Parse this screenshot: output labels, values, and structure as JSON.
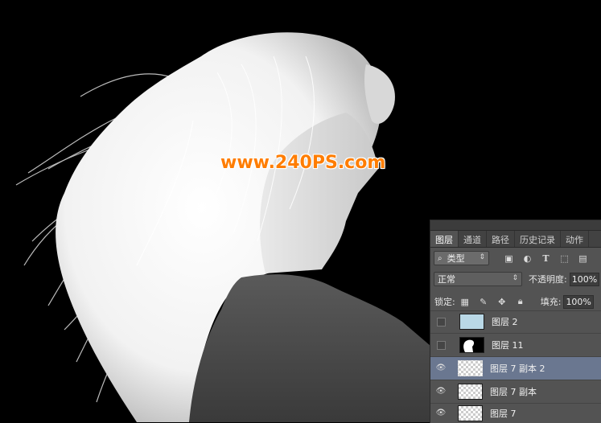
{
  "canvas": {
    "watermark": "www.240PS.com"
  },
  "layers_panel": {
    "tabs": [
      "图层",
      "通道",
      "路径",
      "历史记录",
      "动作"
    ],
    "active_tab": "图层",
    "filter": {
      "kind_label": "类型",
      "kind_icon": "search-icon"
    },
    "filter_icons": [
      "image-filter-icon",
      "adjustment-filter-icon",
      "type-filter-icon",
      "shape-filter-icon",
      "smart-object-filter-icon"
    ],
    "blend_mode": "正常",
    "opacity_label": "不透明度:",
    "opacity_value": "100%",
    "lock_label": "锁定:",
    "fill_label": "填充:",
    "fill_value": "100%",
    "layers": [
      {
        "name": "图层 2",
        "visible": false,
        "thumb": "light-blue",
        "selected": false
      },
      {
        "name": "图层 11",
        "visible": false,
        "thumb": "black-silhouette",
        "selected": false
      },
      {
        "name": "图层 7 副本 2",
        "visible": true,
        "thumb": "transparent",
        "selected": true
      },
      {
        "name": "图层 7 副本",
        "visible": true,
        "thumb": "transparent",
        "selected": false
      },
      {
        "name": "图层 7",
        "visible": true,
        "thumb": "transparent",
        "selected": false
      }
    ]
  },
  "colors": {
    "panel_bg": "#535353",
    "selected_row": "#6a7790",
    "watermark": "#ff7d00"
  }
}
